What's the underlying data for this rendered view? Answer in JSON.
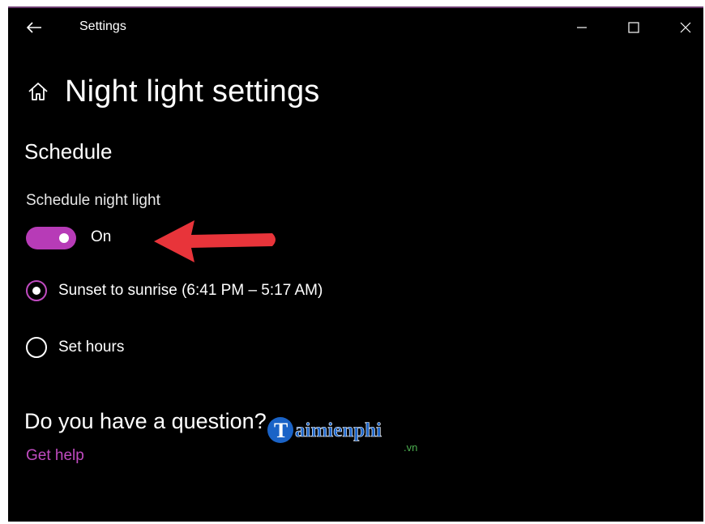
{
  "window": {
    "title": "Settings",
    "back_icon": "back-arrow-icon",
    "controls": [
      "minimize-icon",
      "maximize-icon",
      "close-icon"
    ]
  },
  "page": {
    "home_icon": "home-icon",
    "title": "Night light settings"
  },
  "schedule": {
    "section_title": "Schedule",
    "toggle_label": "Schedule night light",
    "toggle_state": "On",
    "toggle_on": true,
    "options": [
      {
        "label": "Sunset to sunrise (6:41 PM – 5:17 AM)",
        "checked": true
      },
      {
        "label": "Set hours",
        "checked": false
      }
    ]
  },
  "help": {
    "question": "Do you have a question?",
    "link": "Get help"
  },
  "watermark": {
    "brand": "aimienphi",
    "domain": ".vn"
  },
  "colors": {
    "accent": "#b73bb7",
    "link": "#c04bc0",
    "background": "#000000",
    "annotation_arrow": "#e8343a",
    "watermark_blue": "#1a63c7"
  }
}
